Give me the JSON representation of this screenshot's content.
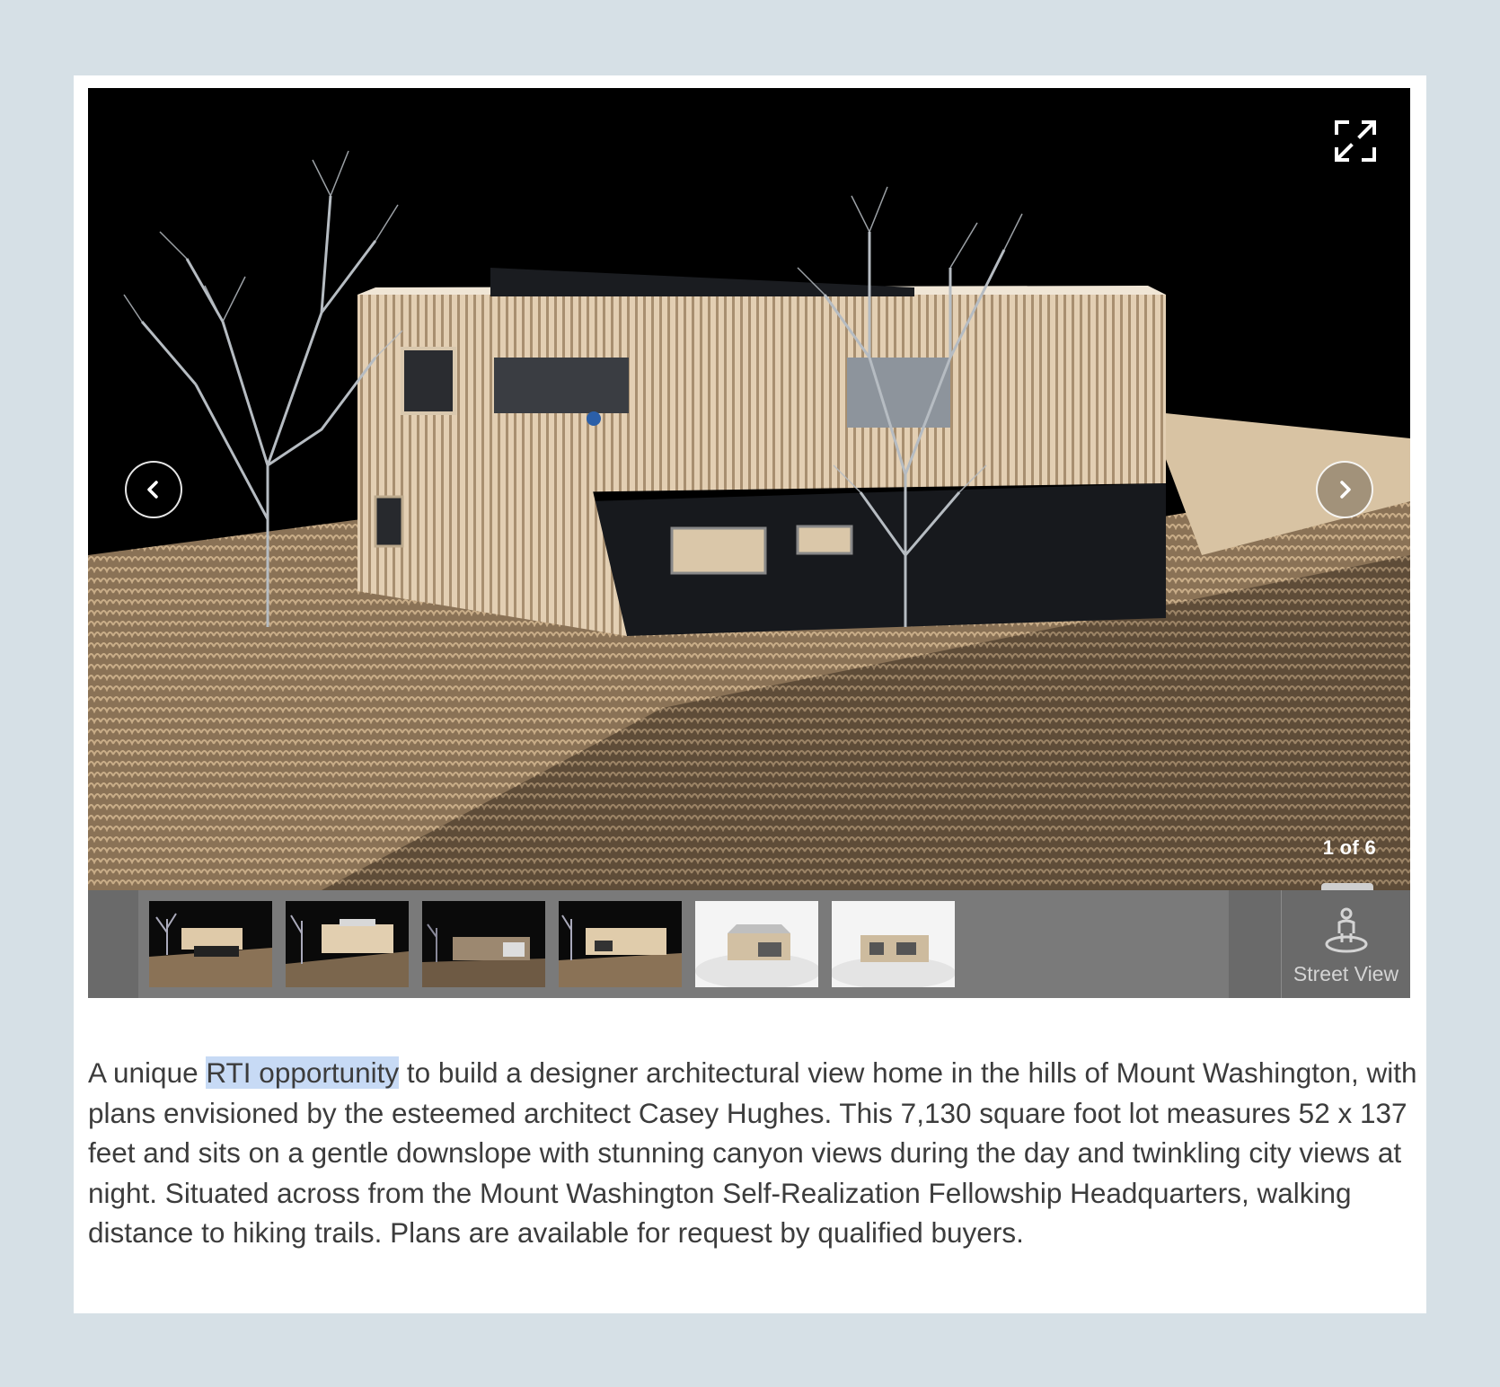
{
  "gallery": {
    "counter": "1 of 6",
    "current_index": 1,
    "total": 6,
    "thumbnails": [
      {
        "style": "dark"
      },
      {
        "style": "dark"
      },
      {
        "style": "dark"
      },
      {
        "style": "dark"
      },
      {
        "style": "light"
      },
      {
        "style": "light"
      }
    ],
    "street_view_label": "Street View",
    "icons": {
      "fullscreen": "fullscreen-icon",
      "prev": "chevron-left-icon",
      "next": "chevron-right-icon",
      "street_view": "pegman-icon"
    }
  },
  "description": {
    "before": "A unique ",
    "highlighted": "RTI opportunity",
    "after": " to build a designer architectural view home in the hills of Mount Washington, with plans envisioned by the esteemed architect Casey Hughes. This 7,130 square foot lot measures 52 x 137 feet and sits on a gentle downslope with stunning canyon views during the day and twinkling city views at night. Situated across from the Mount Washington Self-Realization Fellowship Headquarters, walking distance to hiking trails. Plans are available for request by qualified buyers."
  },
  "colors": {
    "page_background": "#d6e0e6",
    "highlight": "#c7daf5",
    "text": "#3c3c3c",
    "strip": "#7a7a7a"
  }
}
